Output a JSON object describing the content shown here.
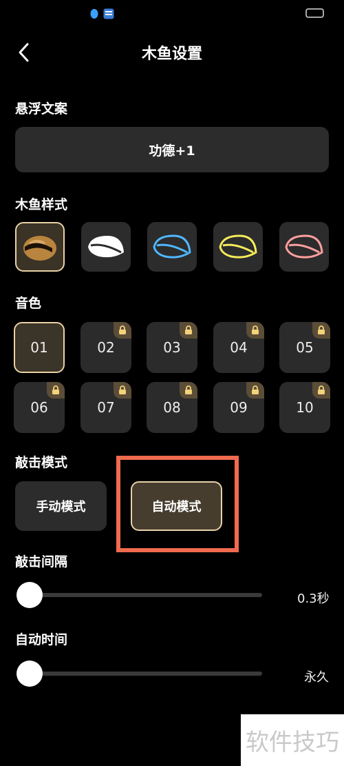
{
  "header": {
    "title": "木鱼设置"
  },
  "float_text": {
    "label": "悬浮文案",
    "value": "功德+1"
  },
  "fish_style": {
    "label": "木鱼样式",
    "items": [
      {
        "name": "classic",
        "selected": true
      },
      {
        "name": "white"
      },
      {
        "name": "neon-blue"
      },
      {
        "name": "neon-yellow"
      },
      {
        "name": "neon-pink"
      }
    ],
    "colors": {
      "neon_blue": "#4fb8ff",
      "neon_yellow": "#f5ec5a",
      "neon_pink": "#ff9f9f"
    }
  },
  "tone": {
    "label": "音色",
    "items": [
      "01",
      "02",
      "03",
      "04",
      "05",
      "06",
      "07",
      "08",
      "09",
      "10"
    ],
    "selected": "01"
  },
  "knock_mode": {
    "label": "敲击模式",
    "manual": "手动模式",
    "auto": "自动模式",
    "selected": "auto"
  },
  "knock_interval": {
    "label": "敲击间隔",
    "value": "0.3秒"
  },
  "auto_time": {
    "label": "自动时间",
    "value": "永久"
  },
  "watermark": "软件技巧",
  "accent": "#e9d3a6",
  "highlight_color": "#f06b4f"
}
